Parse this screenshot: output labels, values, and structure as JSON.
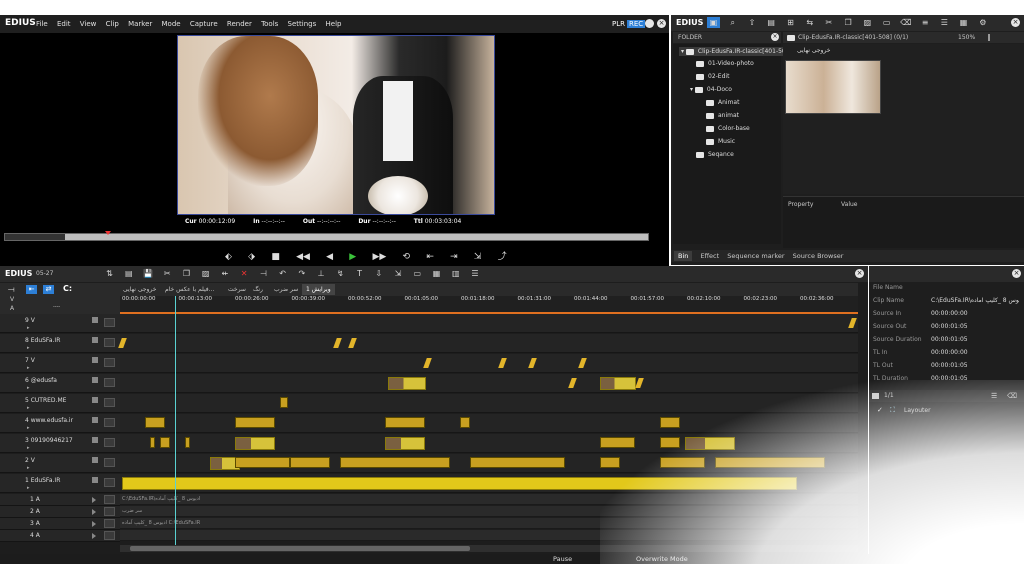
{
  "app": {
    "name": "EDIUS",
    "menu": [
      "File",
      "Edit",
      "View",
      "Clip",
      "Marker",
      "Mode",
      "Capture",
      "Render",
      "Tools",
      "Settings",
      "Help"
    ],
    "plr": "PLR",
    "rec": "REC"
  },
  "player": {
    "cur_label": "Cur",
    "cur_value": "00:00:12:09",
    "in_label": "In",
    "in_value": "--:--:--:--",
    "out_label": "Out",
    "out_value": "--:--:--:--",
    "dur_label": "Dur",
    "dur_value": "--:--:--:--",
    "ttl_label": "Ttl",
    "ttl_value": "00:03:03:04"
  },
  "bin": {
    "title": "EDIUS",
    "folder_label": "FOLDER",
    "clip_path": "Clip-EdusFa.IR-classic[401-508] (0/1)",
    "zoom": "150%",
    "tree": [
      {
        "label": "Clip-EdusFa.IR-classic[401-508]",
        "indent": 0
      },
      {
        "label": "01-Video-photo",
        "indent": 1
      },
      {
        "label": "02-Edit",
        "indent": 1
      },
      {
        "label": "04-Doco",
        "indent": 1
      },
      {
        "label": "Animat",
        "indent": 2
      },
      {
        "label": "animat",
        "indent": 2
      },
      {
        "label": "Color-base",
        "indent": 2
      },
      {
        "label": "Music",
        "indent": 2
      },
      {
        "label": "Seqance",
        "indent": 1
      }
    ],
    "thumb_label": "خروجی نهایی",
    "prop_header": "Property",
    "value_header": "Value",
    "tabs": [
      "Bin",
      "Effect",
      "Sequence marker",
      "Source Browser"
    ]
  },
  "timeline": {
    "title": "EDIUS",
    "sequence": "05-27",
    "tabs": [
      "خروجی نهایی",
      "فیلم با عکس خام...",
      "سرخت",
      "رنگ",
      "سر ضرب",
      "ویرایش 1"
    ],
    "ruler": [
      "00:00:00:00",
      "00:00:13:00",
      "00:00:26:00",
      "00:00:39:00",
      "00:00:52:00",
      "00:01:05:00",
      "00:01:18:00",
      "00:01:31:00",
      "00:01:44:00",
      "00:01:57:00",
      "00:02:10:00",
      "00:02:23:00",
      "00:02:36:00"
    ],
    "tracks": [
      "9 V",
      "8 EduSFa.IR",
      "7 V",
      "6 @edusfa",
      "5 CUTRED.ME",
      "4 www.edusfa.ir",
      "3 09190946217",
      "2 V",
      "1 EduSFa.IR"
    ],
    "audio_tracks": [
      "1 A",
      "2 A",
      "3 A",
      "4 A"
    ],
    "audio_clips": [
      "C:\\EduSFa.IR\\ادیوس 8 _کلیپ آماده",
      "سر ضرب",
      "ادیوس 8 _کلیپ آماده C:\\EduSFa.IR"
    ],
    "track_arrow": "----"
  },
  "info": {
    "rows": [
      {
        "k": "File Name",
        "v": ""
      },
      {
        "k": "Clip Name",
        "v": "C:\\EduSFa.IR\\ادیوس 8 _کلیپ آماده"
      },
      {
        "k": "Source In",
        "v": "00:00:00:00"
      },
      {
        "k": "Source Out",
        "v": "00:00:01:05"
      },
      {
        "k": "Source Duration",
        "v": "00:00:01:05"
      },
      {
        "k": "TL In",
        "v": "00:00:00:00"
      },
      {
        "k": "TL Out",
        "v": "00:00:01:05"
      },
      {
        "k": "TL Duration",
        "v": "00:00:01:05"
      }
    ],
    "page": "1/1",
    "effect": "Layouter"
  },
  "status": {
    "pause": "Pause",
    "mode": "Overwrite Mode"
  },
  "colors": {
    "accent": "#2d7fd6",
    "clip": "#e2c81a",
    "panel": "#1b1b1b"
  }
}
